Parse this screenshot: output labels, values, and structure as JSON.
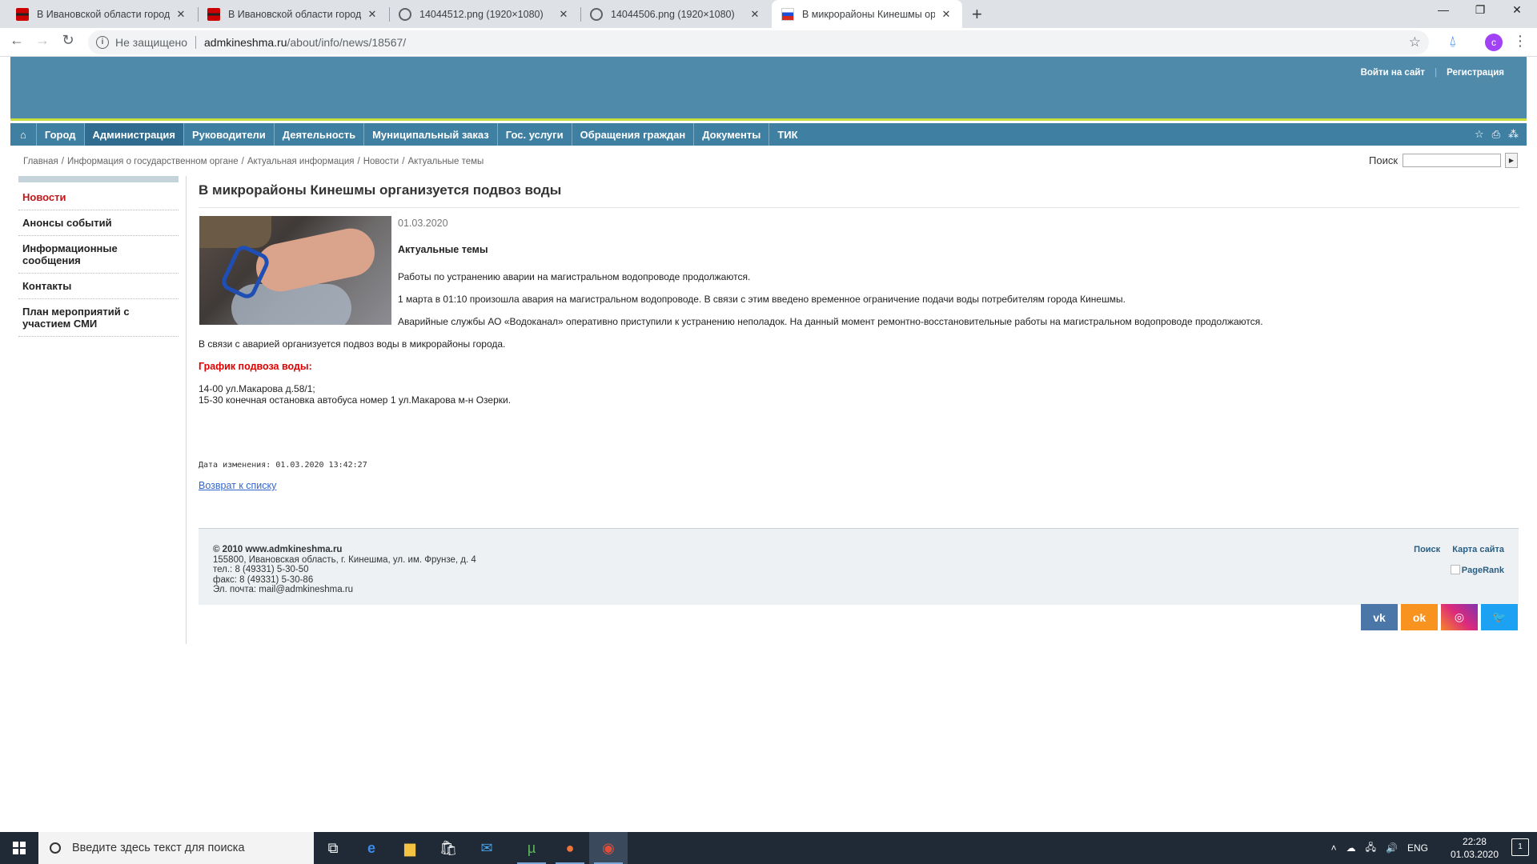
{
  "browser": {
    "tabs": [
      {
        "title": "В Ивановской области городе К",
        "favicon": "ivanovo-favicon"
      },
      {
        "title": "В Ивановской области городе К",
        "favicon": "ivanovo-favicon"
      },
      {
        "title": "14044512.png (1920×1080)",
        "favicon": "globe-icon"
      },
      {
        "title": "14044506.png (1920×1080)",
        "favicon": "globe-icon"
      },
      {
        "title": "В микрорайоны Кинешмы орга",
        "favicon": "russia-flag-icon"
      }
    ],
    "new_tab": "+",
    "window_controls": {
      "minimize": "—",
      "maximize": "❐",
      "close": "✕"
    },
    "address": {
      "security_label": "Не защищено",
      "domain": "admkineshma.ru",
      "path": "/about/info/news/18567/"
    },
    "avatar_letter": "c"
  },
  "site": {
    "auth": {
      "login": "Войти на сайт",
      "register": "Регистрация"
    },
    "nav": {
      "home_icon": "⌂",
      "items": [
        "Город",
        "Администрация",
        "Руководители",
        "Деятельность",
        "Муниципальный заказ",
        "Гос. услуги",
        "Обращения граждан",
        "Документы",
        "ТИК"
      ],
      "active_index": 1
    },
    "breadcrumb": [
      "Главная",
      "Информация о государственном органе",
      "Актуальная информация",
      "Новости",
      "Актуальные темы"
    ],
    "search": {
      "label": "Поиск",
      "go": "▶"
    },
    "left_menu": [
      "Новости",
      "Анонсы событий",
      "Информационные сообщения",
      "Контакты",
      "План мероприятий с участием СМИ"
    ],
    "article": {
      "title": "В микрорайоны Кинешмы организуется подвоз воды",
      "date": "01.03.2020",
      "section": "Актуальные темы",
      "p1": "Работы по устранению аварии на магистральном водопроводе продолжаются.",
      "p2": "1 марта в 01:10 произошла авария на магистральном водопроводе. В связи с этим введено временное ограничение подачи воды потребителям города Кинешмы.",
      "p3": "Аварийные службы АО «Водоканал» оперативно приступили к устранению неполадок. На данный момент ремонтно-восстановительные работы на магистральном водопроводе продолжаются.",
      "p4": "В связи с аварией организуется подвоз воды в микрорайоны города.",
      "schedule_head": "График подвоза воды:",
      "schedule": [
        "14-00 ул.Макарова д.58/1;",
        "15-30 конечная остановка автобуса номер 1 ул.Макарова м-н Озерки."
      ],
      "modified": "Дата изменения: 01.03.2020 13:42:27",
      "back_link": "Возврат к списку"
    },
    "footer": {
      "copyright": "© 2010 www.admkineshma.ru",
      "address": "155800, Ивановская область, г. Кинешма, ул. им. Фрунзе, д. 4",
      "phone": "тел.: 8 (49331) 5-30-50",
      "fax": "факс: 8 (49331) 5-30-86",
      "email": "Эл. почта: mail@admkineshma.ru",
      "search_link": "Поиск",
      "sitemap_link": "Карта сайта",
      "pagerank": "PageRank"
    },
    "social": [
      "vk-icon",
      "odnoklassniki-icon",
      "instagram-icon",
      "twitter-icon"
    ]
  },
  "taskbar": {
    "search_placeholder": "Введите здесь текст для поиска",
    "lang": "ENG",
    "time": "22:28",
    "date": "01.03.2020",
    "notifications": "1"
  }
}
